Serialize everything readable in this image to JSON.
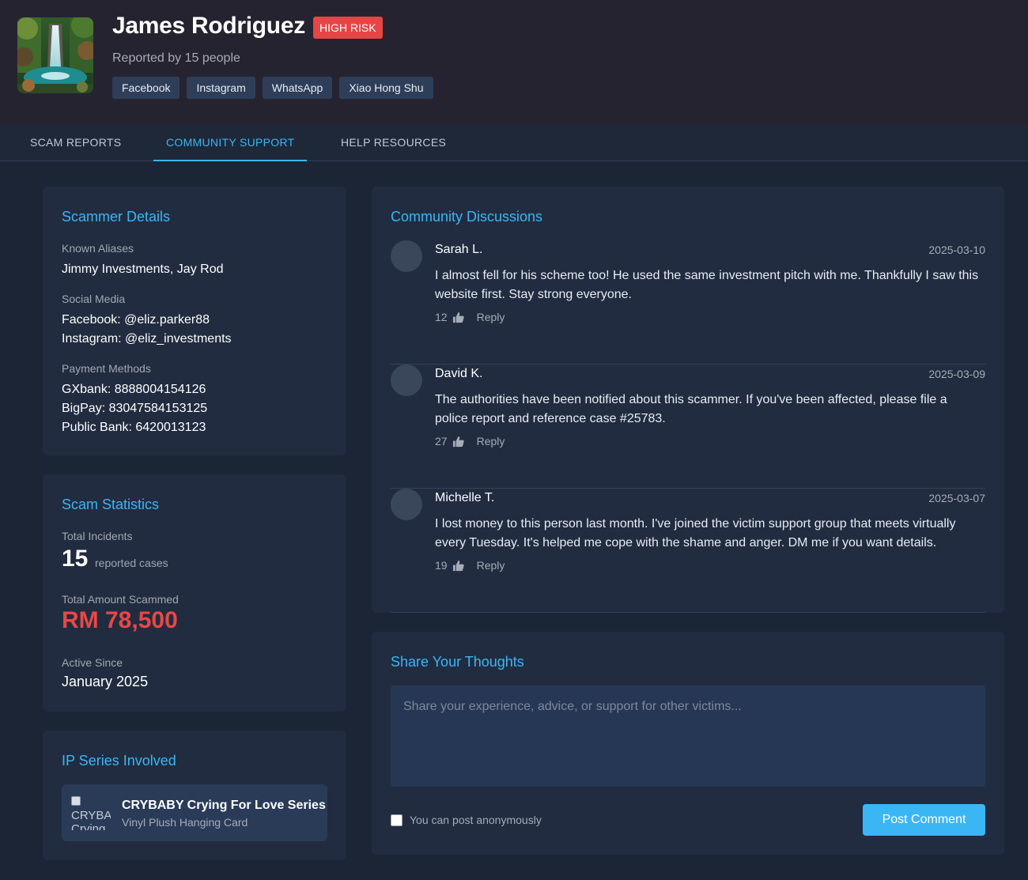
{
  "profile": {
    "name": "James Rodriguez",
    "risk_badge": "HIGH RISK",
    "reported_by": "Reported by 15 people",
    "platforms": [
      "Facebook",
      "Instagram",
      "WhatsApp",
      "Xiao Hong Shu"
    ]
  },
  "tabs": [
    {
      "label": "SCAM REPORTS",
      "active": false
    },
    {
      "label": "COMMUNITY SUPPORT",
      "active": true
    },
    {
      "label": "HELP RESOURCES",
      "active": false
    }
  ],
  "scammer_details": {
    "title": "Scammer Details",
    "aliases_label": "Known Aliases",
    "aliases": "Jimmy Investments, Jay Rod",
    "social_label": "Social Media",
    "social": [
      "Facebook: @eliz.parker88",
      "Instagram: @eliz_investments"
    ],
    "payment_label": "Payment Methods",
    "payments": [
      "GXbank: 8888004154126",
      "BigPay: 83047584153125",
      "Public Bank: 6420013123"
    ]
  },
  "scam_statistics": {
    "title": "Scam Statistics",
    "incidents_label": "Total Incidents",
    "incidents_value": "15",
    "incidents_unit": "reported cases",
    "amount_label": "Total Amount Scammed",
    "amount_value": "RM 78,500",
    "active_label": "Active Since",
    "active_value": "January 2025"
  },
  "ip_series": {
    "title": "IP Series Involved",
    "items": [
      {
        "alt": "CRYBABY Crying For Love Series",
        "name": "CRYBABY Crying For Love Series",
        "desc": "Vinyl Plush Hanging Card"
      }
    ]
  },
  "discussions": {
    "title": "Community Discussions",
    "comments": [
      {
        "author": "Sarah L.",
        "date": "2025-03-10",
        "text": "I almost fell for his scheme too! He used the same investment pitch with me. Thankfully I saw this website first. Stay strong everyone.",
        "likes": "12",
        "reply": "Reply"
      },
      {
        "author": "David K.",
        "date": "2025-03-09",
        "text": "The authorities have been notified about this scammer. If you've been affected, please file a police report and reference case #25783.",
        "likes": "27",
        "reply": "Reply"
      },
      {
        "author": "Michelle T.",
        "date": "2025-03-07",
        "text": "I lost money to this person last month. I've joined the victim support group that meets virtually every Tuesday. It's helped me cope with the shame and anger. DM me if you want details.",
        "likes": "19",
        "reply": "Reply"
      }
    ]
  },
  "share": {
    "title": "Share Your Thoughts",
    "placeholder": "Share your experience, advice, or support for other victims...",
    "anonymous_label": "You can post anonymously",
    "post_button": "Post Comment"
  },
  "colors": {
    "accent": "#3bb6f4",
    "danger": "#e84747",
    "background": "#1b2535",
    "card": "#212c40"
  }
}
